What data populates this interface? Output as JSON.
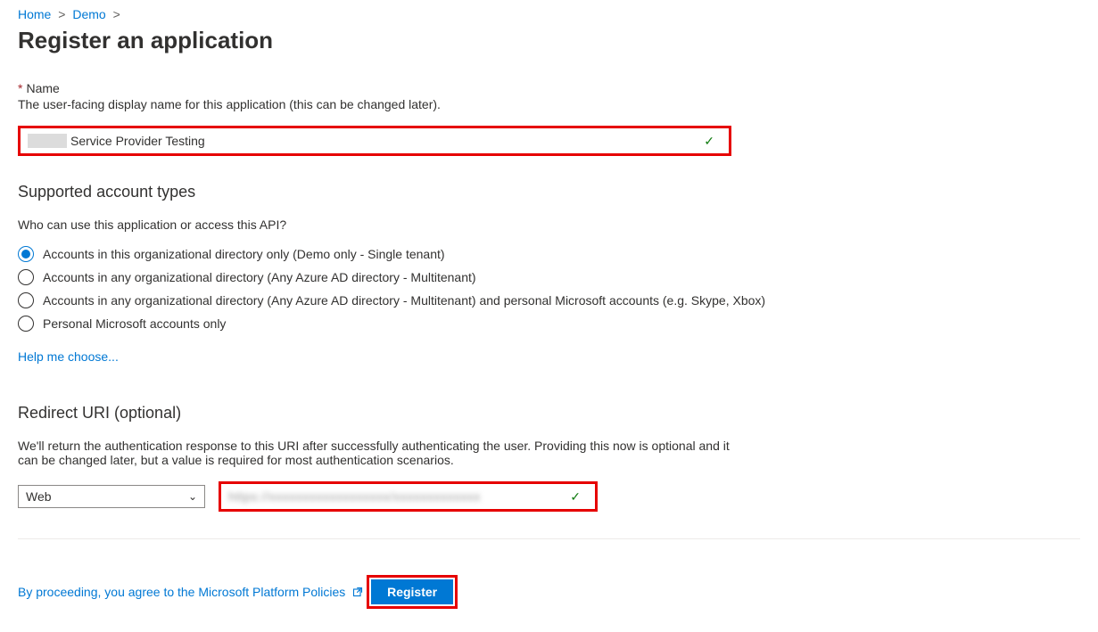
{
  "breadcrumb": {
    "home": "Home",
    "demo": "Demo"
  },
  "page_title": "Register an application",
  "name_section": {
    "label": "Name",
    "desc": "The user-facing display name for this application (this can be changed later).",
    "value_prefix_redacted": true,
    "value_suffix": "Service Provider Testing"
  },
  "account_types": {
    "heading": "Supported account types",
    "question": "Who can use this application or access this API?",
    "options": [
      "Accounts in this organizational directory only (Demo only - Single tenant)",
      "Accounts in any organizational directory (Any Azure AD directory - Multitenant)",
      "Accounts in any organizational directory (Any Azure AD directory - Multitenant) and personal Microsoft accounts (e.g. Skype, Xbox)",
      "Personal Microsoft accounts only"
    ],
    "selected_index": 0,
    "help_link": "Help me choose..."
  },
  "redirect_uri": {
    "heading": "Redirect URI (optional)",
    "desc": "We'll return the authentication response to this URI after successfully authenticating the user. Providing this now is optional and it can be changed later, but a value is required for most authentication scenarios.",
    "platform_selected": "Web",
    "uri_value_redacted": "https://xxxxxxxxxxxxxxxxxx/xxxxxxxxxxxxx"
  },
  "footer": {
    "policy_text": "By proceeding, you agree to the Microsoft Platform Policies",
    "register_label": "Register"
  }
}
